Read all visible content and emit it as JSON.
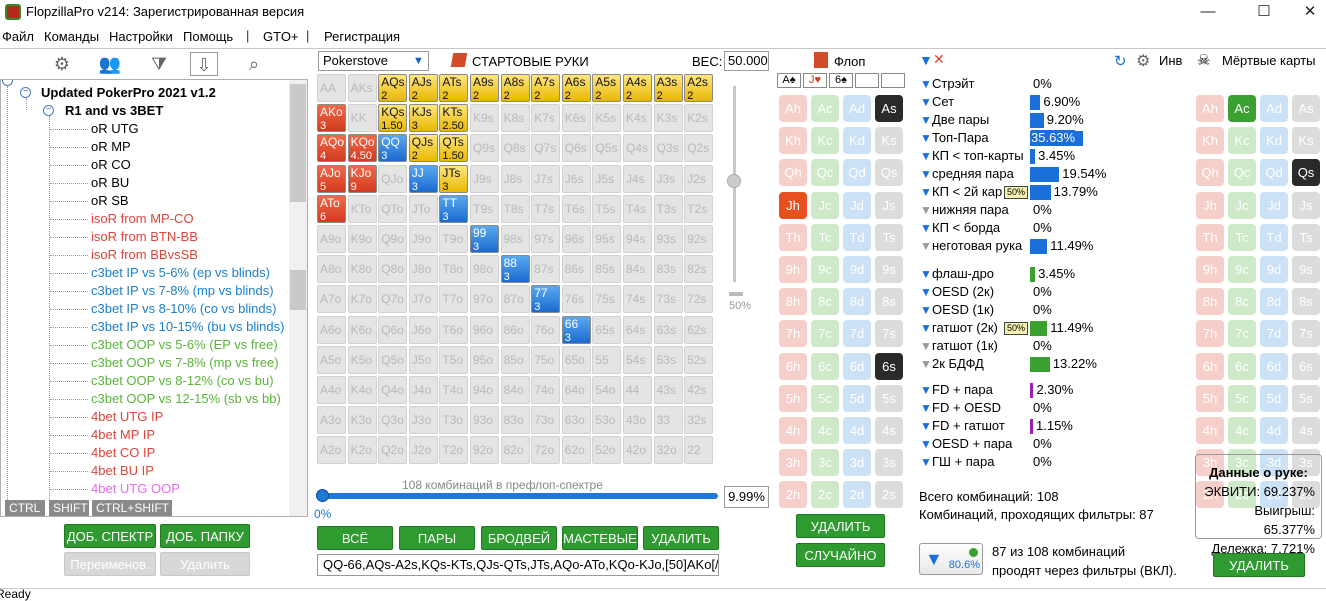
{
  "window": {
    "title": "FlopzillaPro v214: Зарегистрированная версия",
    "minimize": "—",
    "maximize": "☐",
    "close": "✕"
  },
  "menu": {
    "file": "Файл",
    "commands": "Команды",
    "settings": "Настройки",
    "help": "Помощь",
    "sep": "|",
    "gto": "GTO+",
    "register": "Регистрация"
  },
  "tree": {
    "root": "Updated PokerPro 2021 v1.2",
    "folder": "R1 and vs 3BET",
    "items": [
      {
        "label": "oR UTG",
        "color": "#000000"
      },
      {
        "label": "oR MP",
        "color": "#000000"
      },
      {
        "label": "oR CO",
        "color": "#000000"
      },
      {
        "label": "oR BU",
        "color": "#000000"
      },
      {
        "label": "oR SB",
        "color": "#000000"
      },
      {
        "label": "isoR from MP-CO",
        "color": "#e0433a"
      },
      {
        "label": "isoR from BTN-BB",
        "color": "#e0433a"
      },
      {
        "label": "isoR from BBvsSB",
        "color": "#e0433a"
      },
      {
        "label": "c3bet IP vs 5-6% (ep vs blinds)",
        "color": "#1a7fcf"
      },
      {
        "label": "c3bet IP vs 7-8% (mp vs blinds)",
        "color": "#1a7fcf"
      },
      {
        "label": "c3bet IP vs 8-10% (co vs blinds)",
        "color": "#1a7fcf"
      },
      {
        "label": "c3bet IP vs 10-15% (bu vs blinds)",
        "color": "#1a7fcf"
      },
      {
        "label": "c3bet OOP vs 5-6% (EP vs free)",
        "color": "#5ab43a"
      },
      {
        "label": "c3bet OOP vs 7-8% (mp vs free)",
        "color": "#5ab43a"
      },
      {
        "label": "c3bet OOP vs 8-12% (co vs bu)",
        "color": "#5ab43a"
      },
      {
        "label": "c3bet OOP vs 12-15% (sb vs bb)",
        "color": "#5ab43a"
      },
      {
        "label": "4bet UTG IP",
        "color": "#e0433a"
      },
      {
        "label": "4bet MP IP",
        "color": "#e0433a"
      },
      {
        "label": "4bet CO IP",
        "color": "#e0433a"
      },
      {
        "label": "4bet BU IP",
        "color": "#e0433a"
      },
      {
        "label": "4bet UTG OOP",
        "color": "#e36cf0"
      }
    ],
    "kb": [
      "CTRL",
      "SHIFT",
      "CTRL+SHIFT"
    ]
  },
  "left_buttons": {
    "add_range": "ДОБ. СПЕКТР",
    "add_folder": "ДОБ. ПАПКУ",
    "rename": "Переименов.",
    "delete": "Удалить"
  },
  "matrix": {
    "mode": "Pokerstove",
    "title": "СТАРТОВЫЕ РУКИ",
    "weight_label": "ВЕС:",
    "weight": "50.000",
    "ranks": [
      "A",
      "K",
      "Q",
      "J",
      "T",
      "9",
      "8",
      "7",
      "6",
      "5",
      "4",
      "3",
      "2"
    ],
    "selected": {
      "AQs": "2",
      "AJs": "2",
      "ATs": "2",
      "A9s": "2",
      "A8s": "2",
      "A7s": "2",
      "A6s": "2",
      "A5s": "2",
      "A4s": "2",
      "A3s": "2",
      "A2s": "2",
      "KQs": "1.50",
      "KJs": "3",
      "KTs": "2.50",
      "QJs": "2",
      "QTs": "1.50",
      "JTs": "3",
      "AKo": "3",
      "AQo": "4",
      "AJo": "5",
      "ATo": "6",
      "KQo": "4.50",
      "KJo": "9",
      "QQ": "3",
      "JJ": "3",
      "TT": "3",
      "99": "3",
      "88": "3",
      "77": "3",
      "66": "3"
    },
    "slider_pct": "50%",
    "combos_caption": "108 комбинаций в префлоп-спектре",
    "range_zero": "0%",
    "range_pct": "9.99%",
    "buttons": {
      "all": "ВСЁ",
      "pairs": "ПАРЫ",
      "broadways": "БРОДВЕЙ",
      "suited": "МАСТЕВЫЕ",
      "delete": "УДАЛИТЬ"
    },
    "range_text": "QQ-66,AQs-A2s,KQs-KTs,QJs-QTs,JTs,AQo-ATo,KQo-KJo,[50]AKo[/"
  },
  "flop": {
    "title": "Флоп",
    "board": [
      "A♠",
      "J♥",
      "6♠",
      "",
      ""
    ],
    "ranks": [
      "A",
      "K",
      "Q",
      "J",
      "T",
      "9",
      "8",
      "7",
      "6",
      "5",
      "4",
      "3",
      "2"
    ],
    "suits": [
      "h",
      "c",
      "d",
      "s"
    ],
    "selected": {
      "As": "ss",
      "Jh": "hs",
      "6s": "ss"
    },
    "delete": "УДАЛИТЬ",
    "random": "СЛУЧАЙНО"
  },
  "stats": {
    "inv_label": "Инв",
    "groups": [
      [
        {
          "label": "Стрэйт",
          "value": "0%",
          "bar": 0,
          "filt": "on",
          "color": "blue"
        },
        {
          "label": "Сет",
          "value": "6.90%",
          "bar": 6.9,
          "filt": "on",
          "color": "blue"
        },
        {
          "label": "Две пары",
          "value": "9.20%",
          "bar": 9.2,
          "filt": "on",
          "color": "blue"
        },
        {
          "label": "Топ-Пара",
          "value": "35.63%",
          "bar": 35.63,
          "filt": "on",
          "color": "blue",
          "hl": true
        },
        {
          "label": "КП < топ-карты",
          "value": "3.45%",
          "bar": 3.45,
          "filt": "on",
          "color": "blue"
        },
        {
          "label": "средняя пара",
          "value": "19.54%",
          "bar": 19.54,
          "filt": "on",
          "color": "blue"
        },
        {
          "label": "КП < 2й кар",
          "value": "13.79%",
          "bar": 13.79,
          "filt": "on",
          "color": "blue",
          "badge": "50%"
        },
        {
          "label": "нижняя пара",
          "value": "0%",
          "bar": 0,
          "filt": "off",
          "color": "blue"
        },
        {
          "label": "КП < борда",
          "value": "0%",
          "bar": 0,
          "filt": "on",
          "color": "blue"
        },
        {
          "label": "неготовая рука",
          "value": "11.49%",
          "bar": 11.49,
          "filt": "off",
          "color": "blue"
        }
      ],
      [
        {
          "label": "флаш-дро",
          "value": "3.45%",
          "bar": 3.45,
          "filt": "on",
          "color": "green"
        },
        {
          "label": "OESD (2к)",
          "value": "0%",
          "bar": 0,
          "filt": "on",
          "color": "green"
        },
        {
          "label": "OESD (1к)",
          "value": "0%",
          "bar": 0,
          "filt": "on",
          "color": "green"
        },
        {
          "label": "гатшот (2к)",
          "value": "11.49%",
          "bar": 11.49,
          "filt": "on",
          "color": "green",
          "badge": "50%"
        },
        {
          "label": "гатшот (1к)",
          "value": "0%",
          "bar": 0,
          "filt": "off",
          "color": "green"
        },
        {
          "label": "2к БДФД",
          "value": "13.22%",
          "bar": 13.22,
          "filt": "off",
          "color": "green"
        }
      ],
      [
        {
          "label": "FD + пара",
          "value": "2.30%",
          "bar": 2.3,
          "filt": "on",
          "color": "purple"
        },
        {
          "label": "FD + OESD",
          "value": "0%",
          "bar": 0,
          "filt": "on",
          "color": "purple"
        },
        {
          "label": "FD + гатшот",
          "value": "1.15%",
          "bar": 1.15,
          "filt": "on",
          "color": "purple"
        },
        {
          "label": "OESD + пара",
          "value": "0%",
          "bar": 0,
          "filt": "on",
          "color": "purple"
        },
        {
          "label": "ГШ + пара",
          "value": "0%",
          "bar": 0,
          "filt": "on",
          "color": "purple"
        }
      ]
    ],
    "total": "Всего комбинаций: 108",
    "passing": "Комбинаций, проходящих фильтры: 87",
    "filter_pct": "80.6%",
    "filter_info_1": "87 из 108 комбинаций",
    "filter_info_2": "проодят через фильтры (ВКЛ)."
  },
  "dead": {
    "title": "Мёртвые карты",
    "selected": {
      "Ac": "cs",
      "Qs": "ss"
    },
    "hand_data_title": "Данные о руке:",
    "equity": "ЭКВИТИ: 69.237%",
    "win": "Выигрыш: 65.377%",
    "tie": "Дележка: 7.721%",
    "delete": "УДАЛИТЬ"
  },
  "status": "Ready"
}
